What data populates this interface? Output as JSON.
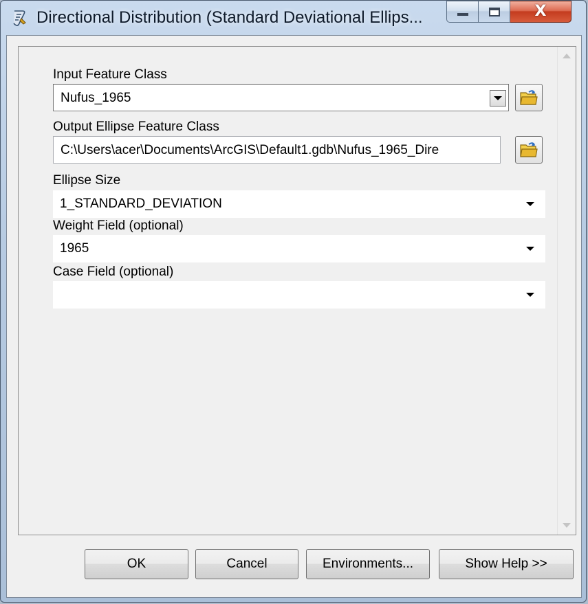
{
  "window": {
    "title": "Directional Distribution (Standard Deviational Ellips...",
    "icons": {
      "app": "script-tool-icon",
      "minimize": "minimize-icon",
      "maximize": "maximize-icon",
      "close": "close-icon"
    },
    "close_glyph": "X"
  },
  "params": {
    "input_feature_class": {
      "label": "Input Feature Class",
      "value": "Nufus_1965"
    },
    "output_ellipse_feature_class": {
      "label": "Output Ellipse Feature Class",
      "value": "C:\\Users\\acer\\Documents\\ArcGIS\\Default1.gdb\\Nufus_1965_Dire"
    },
    "ellipse_size": {
      "label": "Ellipse Size",
      "value": "1_STANDARD_DEVIATION"
    },
    "weight_field": {
      "label": "Weight Field (optional)",
      "value": "1965"
    },
    "case_field": {
      "label": "Case Field (optional)",
      "value": ""
    }
  },
  "buttons": {
    "ok": "OK",
    "cancel": "Cancel",
    "environments": "Environments...",
    "show_help": "Show Help >>"
  },
  "colors": {
    "title_bar": "#b7cbe2",
    "close_button": "#c43c1f",
    "folder_icon": "#e8b830"
  }
}
